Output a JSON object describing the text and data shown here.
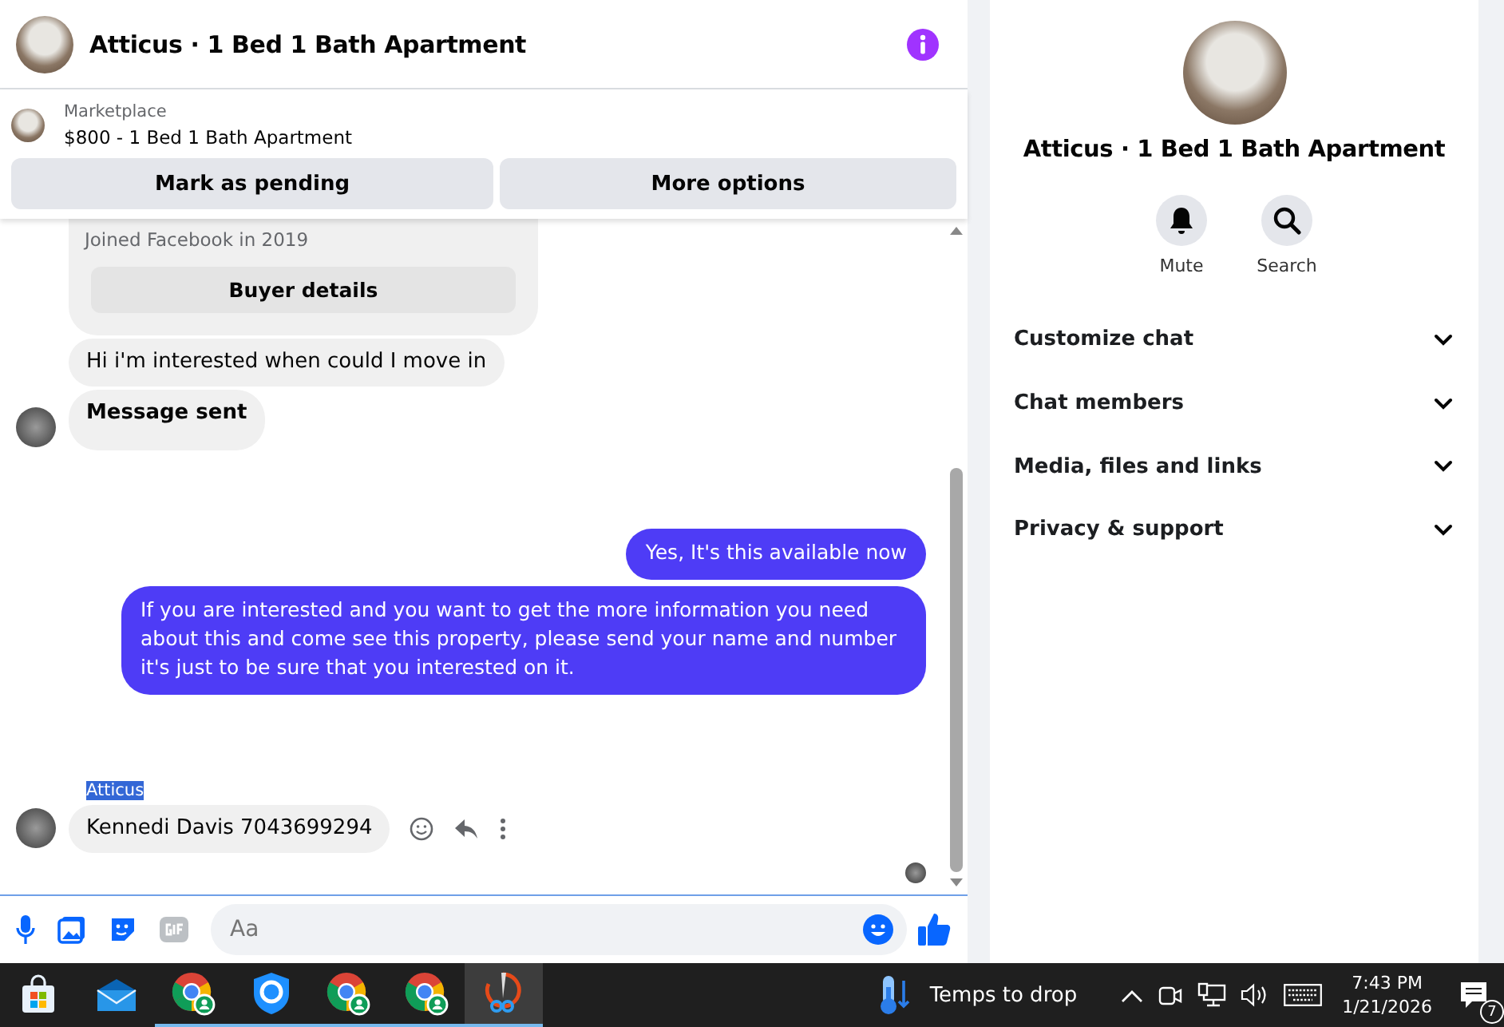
{
  "chat": {
    "title": "Atticus · 1 Bed 1 Bath Apartment",
    "listing": {
      "source": "Marketplace",
      "title": "$800 - 1 Bed 1 Bath Apartment"
    },
    "actions": [
      "Mark as pending",
      "More options"
    ],
    "buyer_card": {
      "joined": "Joined Facebook in 2019",
      "button": "Buyer details"
    },
    "messages": [
      {
        "kind": "incoming",
        "text": "Hi i'm interested when could I move in",
        "avatar": false,
        "bold": false
      },
      {
        "kind": "incoming",
        "text": "Message sent",
        "avatar": true,
        "bold": true
      },
      {
        "kind": "outgoing",
        "text": "Yes, It's this available now"
      },
      {
        "kind": "outgoing",
        "text": "If you are interested and you want to get the more information you need about this and come see this property, please send your name and number it's just to be sure that you interested on it."
      },
      {
        "kind": "incoming",
        "sender": "Atticus",
        "sender_selected": true,
        "text": "Kennedi Davis 7043699294",
        "avatar": true,
        "bold": false,
        "hover_actions": true
      }
    ],
    "composer": {
      "placeholder": "Aa"
    }
  },
  "details": {
    "title": "Atticus · 1 Bed 1 Bath Apartment",
    "buttons": [
      {
        "kind": "mute",
        "label": "Mute"
      },
      {
        "kind": "search",
        "label": "Search"
      }
    ],
    "sections": [
      {
        "label": "Customize chat",
        "expanded": false
      },
      {
        "label": "Chat members",
        "expanded": false
      },
      {
        "label": "Media, files and links",
        "expanded": false
      },
      {
        "label": "Privacy & support",
        "expanded": false
      }
    ]
  },
  "taskbar": {
    "apps": [
      {
        "kind": "store",
        "running": false,
        "active": false
      },
      {
        "kind": "mail",
        "running": false,
        "active": false
      },
      {
        "kind": "chrome",
        "running": true,
        "active": false
      },
      {
        "kind": "shield",
        "running": true,
        "active": false
      },
      {
        "kind": "chrome",
        "running": true,
        "active": false
      },
      {
        "kind": "chrome",
        "running": true,
        "active": false
      },
      {
        "kind": "snip",
        "running": true,
        "active": true
      }
    ],
    "weather": "Temps to drop",
    "time": "7:43 PM",
    "date": "1/21/2026",
    "notifications": "7"
  }
}
